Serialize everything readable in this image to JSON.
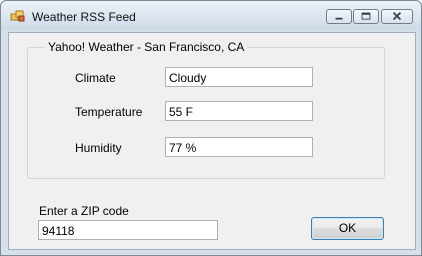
{
  "window": {
    "title": "Weather RSS Feed",
    "app_icon": "app-window-icon",
    "controls": [
      "minimize-icon",
      "maximize-icon",
      "close-icon"
    ]
  },
  "group": {
    "title": "Yahoo! Weather - San Francisco, CA"
  },
  "fields": {
    "climate": {
      "label": "Climate",
      "value": "Cloudy"
    },
    "temperature": {
      "label": "Temperature",
      "value": "55 F"
    },
    "humidity": {
      "label": "Humidity",
      "value": "77 %"
    }
  },
  "zip": {
    "label": "Enter a ZIP code",
    "value": "94118"
  },
  "ok_button": {
    "label": "OK"
  }
}
